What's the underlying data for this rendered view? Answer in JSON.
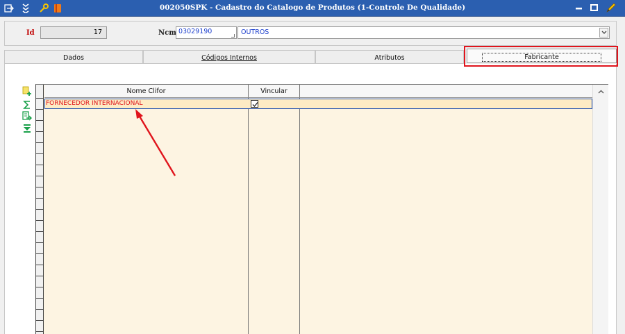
{
  "window": {
    "title": "002050SPK - Cadastro do Catalogo de Produtos (1-Controle De Qualidade)",
    "colors": {
      "titlebar": "#2b5fb0",
      "accent_red": "#e0141c",
      "grid_bg": "#fdf4e2"
    }
  },
  "form": {
    "id_label": "Id",
    "id_value": "17",
    "ncm_label": "Ncm",
    "ncm_code": "03029190",
    "ncm_description": "OUTROS"
  },
  "tabs": [
    {
      "label": "Dados",
      "active": false
    },
    {
      "label": "Códigos Internos",
      "active": false
    },
    {
      "label": "Atributos",
      "active": false
    },
    {
      "label": "Fabricante",
      "active": true
    }
  ],
  "grid": {
    "columns": [
      "Nome Clifor",
      "Vincular"
    ],
    "rows": [
      {
        "nome_clifor": "FORNECEDOR INTERNACIONAL",
        "vincular": true
      }
    ]
  },
  "toolbar_icons": [
    "add-row-icon",
    "sum-icon",
    "export-icon",
    "filter-icon"
  ]
}
